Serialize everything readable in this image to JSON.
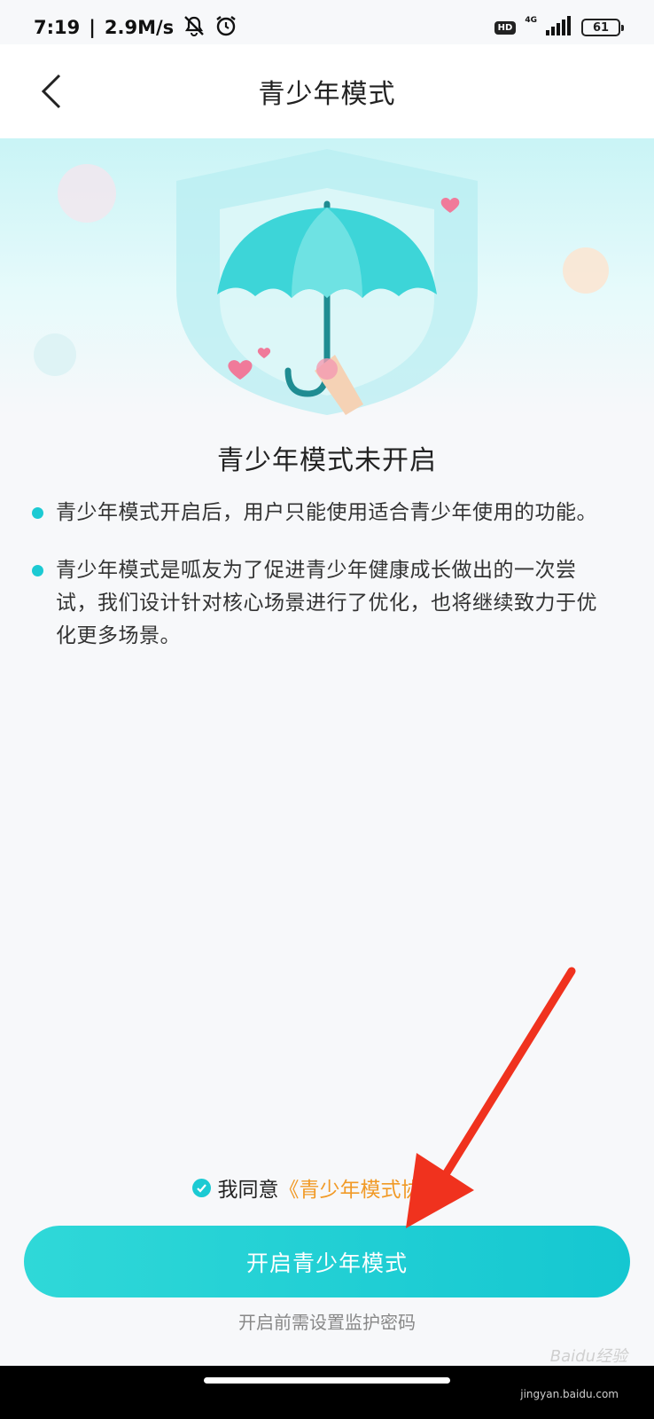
{
  "status_bar": {
    "time": "7:19",
    "network_speed": "2.9M/s",
    "hd": "HD",
    "network_type": "4G",
    "battery": "61",
    "icons": [
      "mute-icon",
      "alarm-icon",
      "signal-icon",
      "battery-icon"
    ]
  },
  "header": {
    "title": "青少年模式",
    "back_icon": "chevron-left-icon"
  },
  "main": {
    "headline": "青少年模式未开启",
    "bullets": [
      {
        "text": "青少年模式开启后，用户只能使用适合青少年使用的功能。"
      },
      {
        "text": "青少年模式是呱友为了促进青少年健康成长做出的一次尝试，我们设计针对核心场景进行了优化，也将继续致力于优化更多场景。"
      }
    ]
  },
  "footer": {
    "agree_text": "我同意",
    "agreement_link": "《青少年模式协议》",
    "primary_button": "开启青少年模式",
    "hint": "开启前需设置监护密码"
  },
  "watermark": {
    "text": "Baidu经验",
    "sub": "jingyan.baidu.com"
  },
  "colors": {
    "accent": "#1ccad3",
    "link": "#f19a27",
    "annotation_arrow": "#f0321e"
  }
}
